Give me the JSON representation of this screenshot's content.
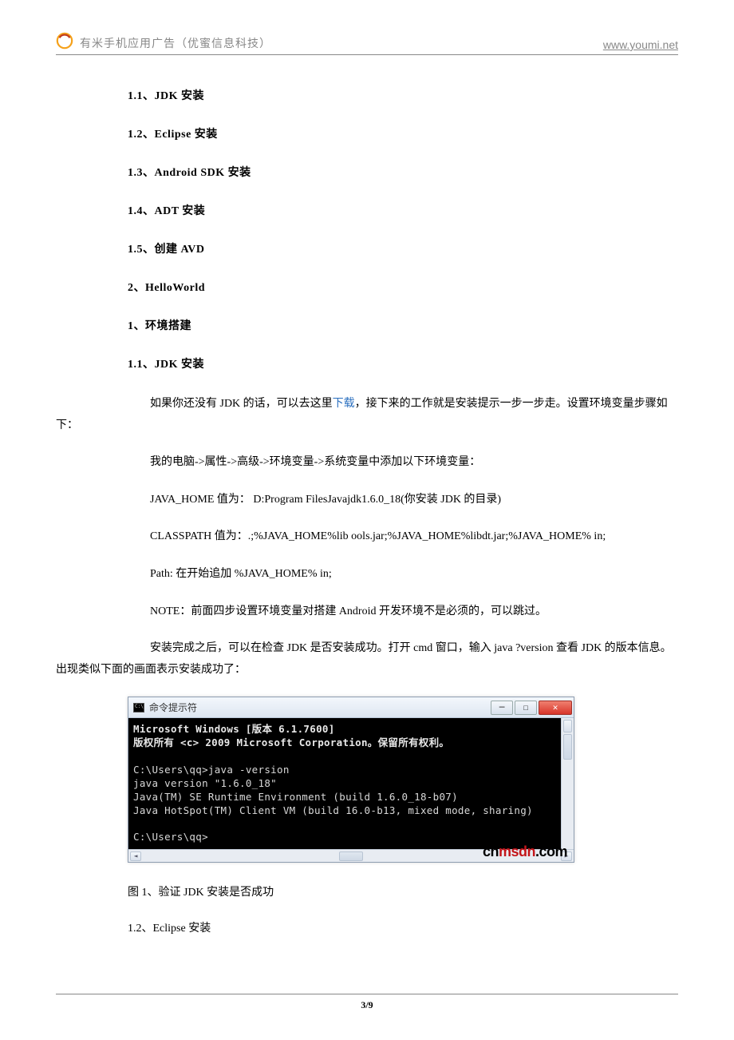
{
  "header": {
    "title": "有米手机应用广告（优蜜信息科技）",
    "url": "www.youmi.net"
  },
  "toc": {
    "i1": "1.1、JDK 安装",
    "i2": "1.2、Eclipse 安装",
    "i3": "1.3、Android SDK 安装",
    "i4": "1.4、ADT 安装",
    "i5": "1.5、创建 AVD",
    "i6": "2、HelloWorld",
    "i7": "1、环境搭建",
    "i8": "1.1、JDK 安装"
  },
  "body": {
    "p1a": "如果你还没有 JDK 的话，可以去这里",
    "p1link": "下载",
    "p1b": "，接下来的工作就是安装提示一步一步走。设置环境变量步骤如下：",
    "p2": "我的电脑->属性->高级->环境变量->系统变量中添加以下环境变量：",
    "p3": "JAVA_HOME 值为： D:Program FilesJavajdk1.6.0_18(你安装 JDK 的目录)",
    "p4": "CLASSPATH 值为：.;%JAVA_HOME%lib ools.jar;%JAVA_HOME%libdt.jar;%JAVA_HOME%  in;",
    "p5": "Path:  在开始追加 %JAVA_HOME%  in;",
    "p6": "NOTE：前面四步设置环境变量对搭建 Android 开发环境不是必须的，可以跳过。",
    "p7": "安装完成之后，可以在检查 JDK 是否安装成功。打开 cmd 窗口，输入 java ?version 查看 JDK 的版本信息。出现类似下面的画面表示安装成功了："
  },
  "cmd": {
    "title": "命令提示符",
    "line1": "Microsoft Windows [版本 6.1.7600]",
    "line2": "版权所有 <c> 2009 Microsoft Corporation。保留所有权利。",
    "line3": "C:\\Users\\qq>java -version",
    "line4": "java version \"1.6.0_18\"",
    "line5": "Java(TM) SE Runtime Environment (build 1.6.0_18-b07)",
    "line6": "Java HotSpot(TM) Client VM (build 16.0-b13, mixed mode, sharing)",
    "line7": "C:\\Users\\qq>",
    "watermark_a": "cn",
    "watermark_b": "msdn",
    "watermark_c": ".com"
  },
  "caption": "图 1、验证 JDK 安装是否成功",
  "next": "1.2、Eclipse 安装",
  "pager": "3/9"
}
